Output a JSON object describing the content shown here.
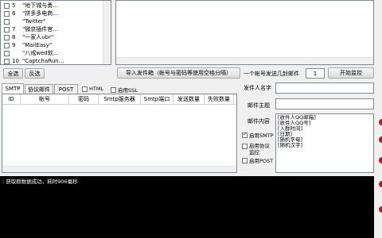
{
  "account_list": {
    "rows": [
      {
        "num": "5",
        "text": "\"地下城与勇…"
      },
      {
        "num": "6",
        "text": "\"拼多多电商…"
      },
      {
        "num": "",
        "text": "\"Twitter\""
      },
      {
        "num": "7",
        "text": "\"微京插件官…"
      },
      {
        "num": "8",
        "text": "\"一家人ubr\""
      },
      {
        "num": "9",
        "text": "\"MailEasy\""
      },
      {
        "num": "",
        "text": "\"八戒wed软…"
      },
      {
        "num": "10",
        "text": "\"CaptchaRun…"
      }
    ]
  },
  "actions": {
    "select_all": "全选",
    "invert": "反选",
    "import_sender": "导入发件箱（帐号与密码等使用空格分隔）",
    "per_account_label": "一个帐号发送几封邮件",
    "per_account_value": "1",
    "start": "开始监控"
  },
  "tabs": [
    "SMTP",
    "协议邮件",
    "POST"
  ],
  "options": {
    "html": "HTML",
    "ssl": "启用SSL"
  },
  "table": {
    "columns": [
      "ID",
      "帐号",
      "密码",
      "Smtp服务器",
      "Smtp端口",
      "发送数量",
      "失败数量"
    ]
  },
  "form": {
    "sender_name_label": "发件人名字",
    "sender_name_value": "",
    "subject_label": "邮件主题",
    "subject_value": "",
    "content_label": "邮件内容",
    "content_lines": [
      "[收件人QQ邮箱]",
      "[收件人QQ号]",
      "[入群时间]",
      "[日期]",
      "[随机字母]",
      "[随机汉字]"
    ],
    "cb_smtp": "启用SMTP",
    "cb_protocol_1": "启用协议",
    "cb_protocol_2": "监控",
    "cb_post": "启用POST"
  },
  "log": {
    "line": ": 获取群数据成功，耗时906毫秒"
  },
  "colors": {
    "accent_dot": "#c8102e"
  }
}
